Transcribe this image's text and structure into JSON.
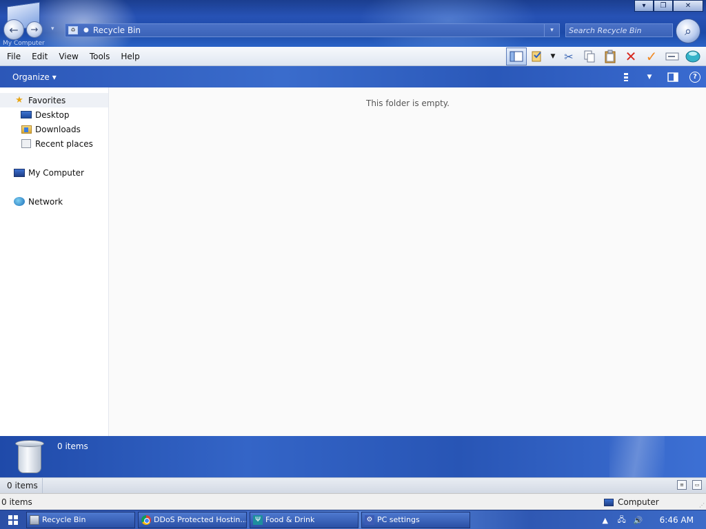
{
  "window": {
    "computer_caption": "My Computer",
    "address": {
      "path": "Recycle Bin"
    },
    "search": {
      "placeholder": "Search Recycle Bin"
    },
    "controls": {
      "minimize": "▾",
      "maximize": "❐",
      "close": "✕"
    }
  },
  "menu": {
    "items": [
      {
        "label": "File"
      },
      {
        "label": "Edit"
      },
      {
        "label": "View"
      },
      {
        "label": "Tools"
      },
      {
        "label": "Help"
      }
    ]
  },
  "toolbar": {
    "icons": [
      "layout-icon",
      "properties-icon",
      "dropdown-icon",
      "cut-icon",
      "copy-icon",
      "paste-icon",
      "delete-icon",
      "check-icon",
      "rename-icon",
      "globe-icon"
    ]
  },
  "commandbar": {
    "organize_label": "Organize",
    "organize_arrow": "▾"
  },
  "navpane": {
    "favorites": {
      "label": "Favorites",
      "items": [
        {
          "label": "Desktop"
        },
        {
          "label": "Downloads"
        },
        {
          "label": "Recent places"
        }
      ]
    },
    "computer": {
      "label": "My Computer"
    },
    "network": {
      "label": "Network"
    }
  },
  "content": {
    "empty_message": "This folder is empty."
  },
  "details": {
    "count": "0 items"
  },
  "statusbar": {
    "count": "0 items"
  },
  "outer_status": {
    "count": "0 items",
    "zone": "Computer"
  },
  "taskbar": {
    "tasks": [
      {
        "label": "Recycle Bin"
      },
      {
        "label": "DDoS Protected Hostin..."
      },
      {
        "label": "Food & Drink"
      },
      {
        "label": "PC settings"
      }
    ],
    "clock": "6:46 AM"
  },
  "colors": {
    "accent": "#2c57b8",
    "taskbar": "#3a63c0"
  }
}
